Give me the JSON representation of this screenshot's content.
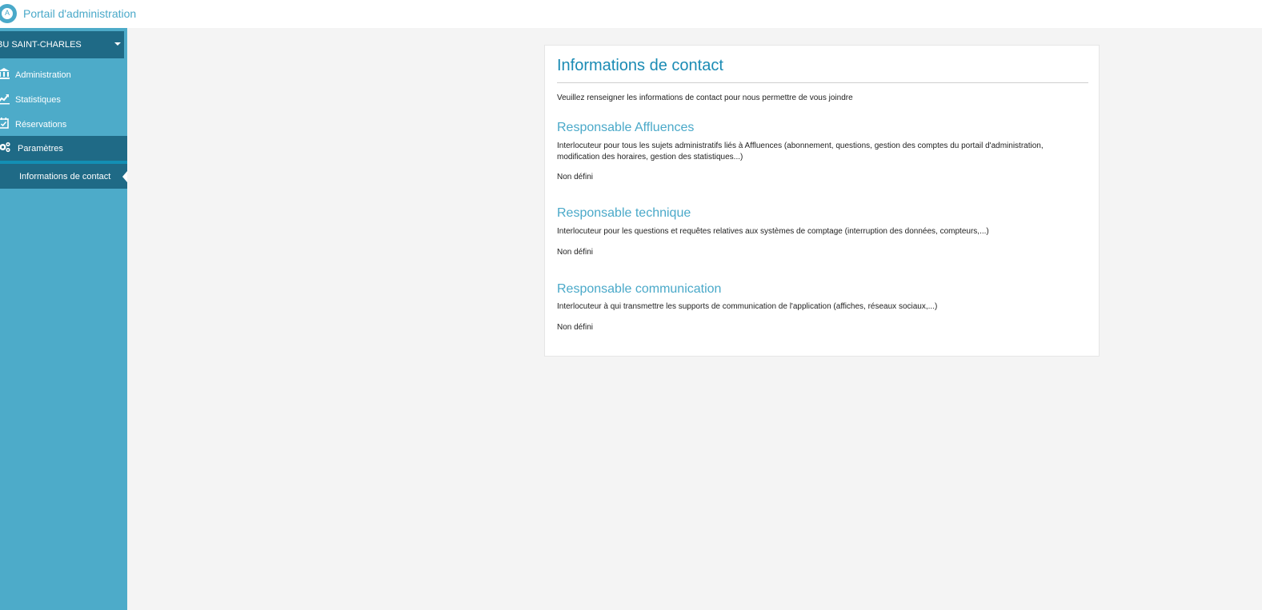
{
  "header": {
    "logo_icon": "affluences-logo-icon",
    "logo_glyph": "A",
    "title": "Portail d'administration"
  },
  "sidebar": {
    "site_selector": "BU SAINT-CHARLES",
    "items": [
      {
        "label": "Administration",
        "icon": "bank-icon"
      },
      {
        "label": "Statistiques",
        "icon": "chart-line-icon"
      },
      {
        "label": "Réservations",
        "icon": "calendar-check-icon"
      },
      {
        "label": "Paramètres",
        "icon": "gears-icon"
      }
    ],
    "sub_item": "Informations de contact"
  },
  "main": {
    "title": "Informations de contact",
    "intro": "Veuillez renseigner les informations de contact pour nous permettre de vous joindre",
    "sections": [
      {
        "title": "Responsable Affluences",
        "description": "Interlocuteur pour tous les sujets administratifs liés à Affluences (abonnement, questions, gestion des comptes du portail d'administration, modification des horaires, gestion des statistiques...)",
        "value": "Non défini"
      },
      {
        "title": "Responsable technique",
        "description": "Interlocuteur pour les questions et requêtes relatives aux systèmes de comptage (interruption des données, compteurs,...)",
        "value": "Non défini"
      },
      {
        "title": "Responsable communication",
        "description": "Interlocuteur à qui transmettre les supports de communication de l'application (affiches, réseaux sociaux,...)",
        "value": "Non défini"
      }
    ]
  },
  "colors": {
    "sidebar": "#4dabc9",
    "sidebar_active": "#1f6a86",
    "accent": "#138fb4",
    "title": "#1a8bb4",
    "section_title": "#4aa9c9",
    "background": "#f4f4f4"
  }
}
